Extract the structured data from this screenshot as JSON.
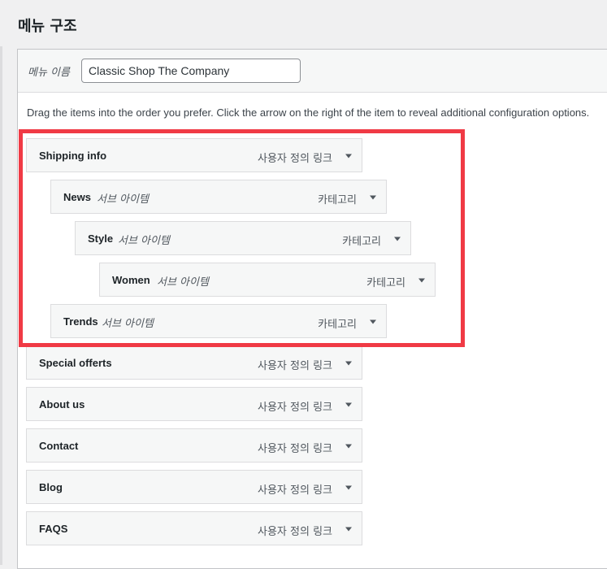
{
  "page": {
    "title": "메뉴 구조"
  },
  "menu_name": {
    "label": "메뉴 이름",
    "value": "Classic Shop The Company"
  },
  "instructions": "Drag the items into the order you prefer. Click the arrow on the right of the item to reveal additional configuration options.",
  "menu_items": [
    {
      "title": "Shipping info",
      "sub_label": "",
      "type": "사용자 정의 링크",
      "depth": 0
    },
    {
      "title": "News",
      "sub_label": "서브 아이템",
      "type": "카테고리",
      "depth": 1
    },
    {
      "title": "Style",
      "sub_label": "서브 아이템",
      "type": "카테고리",
      "depth": 2
    },
    {
      "title": "Women",
      "sub_label": "서브 아이템",
      "type": "카테고리",
      "depth": 3
    },
    {
      "title": "Trends",
      "sub_label": "서브 아이템",
      "type": "카테고리",
      "depth": 1
    },
    {
      "title": "Special offerts",
      "sub_label": "",
      "type": "사용자 정의 링크",
      "depth": 0
    },
    {
      "title": "About us",
      "sub_label": "",
      "type": "사용자 정의 링크",
      "depth": 0
    },
    {
      "title": "Contact",
      "sub_label": "",
      "type": "사용자 정의 링크",
      "depth": 0
    },
    {
      "title": "Blog",
      "sub_label": "",
      "type": "사용자 정의 링크",
      "depth": 0
    },
    {
      "title": "FAQS",
      "sub_label": "",
      "type": "사용자 정의 링크",
      "depth": 0
    }
  ],
  "colors": {
    "highlight": "#f03a45",
    "item_background": "#f6f7f7",
    "item_border": "#dcdcde"
  },
  "icons": {
    "toggle": "caret-down-icon"
  }
}
